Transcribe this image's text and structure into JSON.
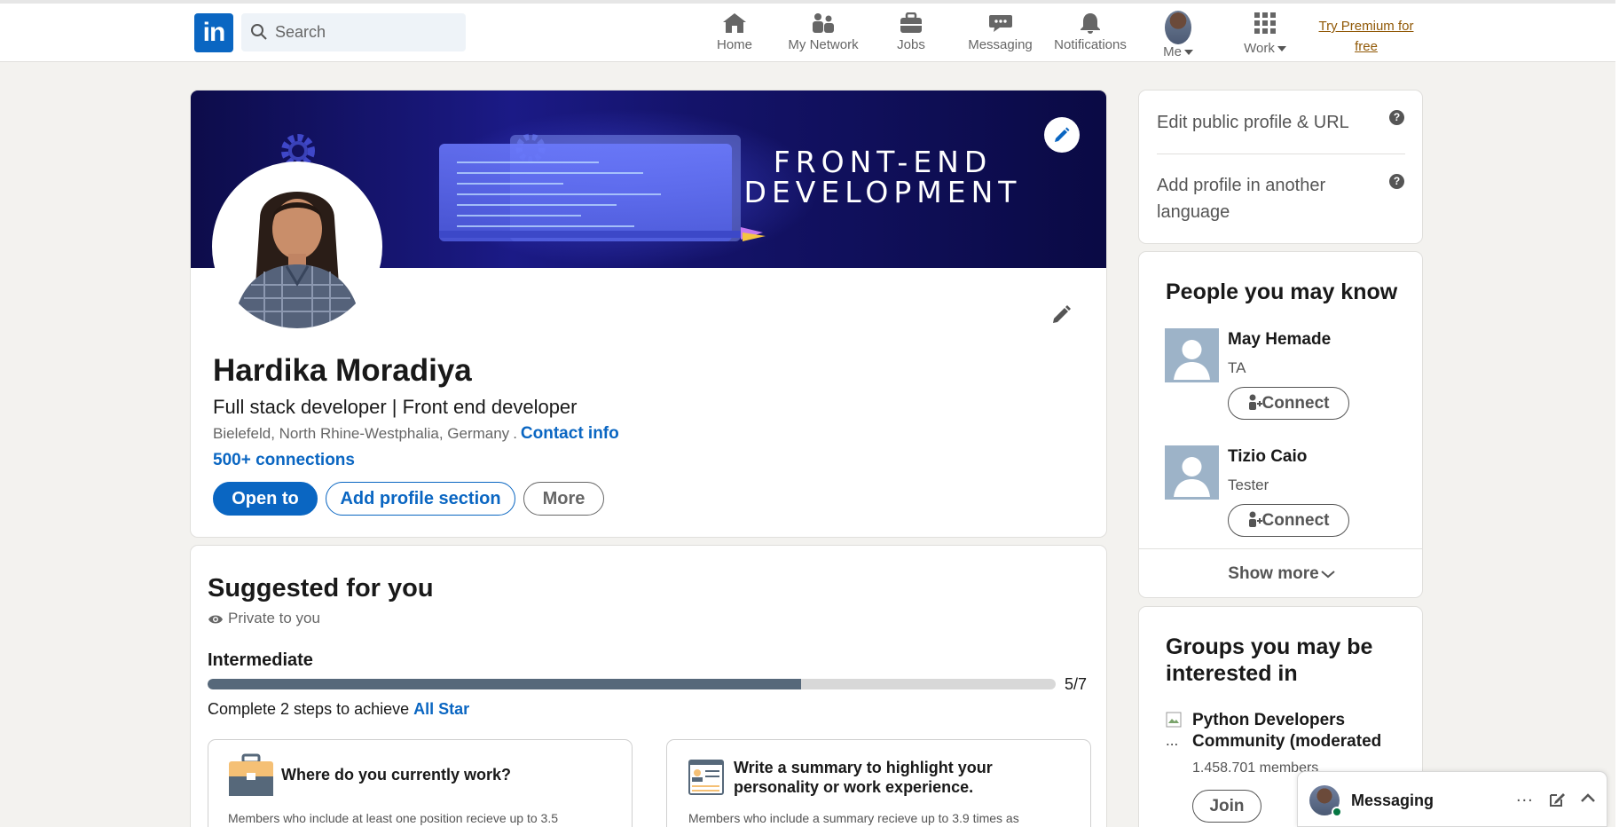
{
  "nav": {
    "search_placeholder": "Search",
    "items": [
      {
        "label": "Home",
        "icon": "home-icon"
      },
      {
        "label": "My Network",
        "icon": "network-icon"
      },
      {
        "label": "Jobs",
        "icon": "briefcase-icon"
      },
      {
        "label": "Messaging",
        "icon": "messaging-icon"
      },
      {
        "label": "Notifications",
        "icon": "bell-icon"
      },
      {
        "label": "Me",
        "icon": "avatar"
      },
      {
        "label": "Work",
        "icon": "grid-icon"
      }
    ],
    "premium": "Try Premium for free"
  },
  "profile": {
    "banner_text": "FRONT-END DEVELOPMENT",
    "name": "Hardika Moradiya",
    "headline": "Full stack developer | Front end developer",
    "location": "Bielefeld, North Rhine-Westphalia, Germany",
    "location_sep": ".",
    "contact_info": "Contact info",
    "connections": "500+ connections",
    "buttons": {
      "open_to": "Open to",
      "add_section": "Add profile section",
      "more": "More"
    }
  },
  "suggested": {
    "title": "Suggested for you",
    "private": "Private to you",
    "level": "Intermediate",
    "progress_fraction": 0.7,
    "progress_text": "5/7",
    "steps_text": "Complete 2 steps to achieve",
    "steps_link": "All Star",
    "tiles": [
      {
        "title": "Where do you currently work?",
        "body": "Members who include at least one position recieve up to 3.5"
      },
      {
        "title": "Write a summary to highlight your personality or work experience.",
        "body": "Members who include a summary recieve up to 3.9 times as"
      }
    ]
  },
  "sidebar": {
    "edit_profile": "Edit public profile & URL",
    "add_language": "Add profile in another language",
    "help_glyph": "?",
    "people_title": "People you may know",
    "people": [
      {
        "name": "May Hemade",
        "title": "TA",
        "button": "Connect"
      },
      {
        "name": "Tizio Caio",
        "title": "Tester",
        "button": "Connect"
      }
    ],
    "show_more": "Show more",
    "groups_title": "Groups you may be interested in",
    "group": {
      "img_alt": "...",
      "name": "Python Developers Community (moderated",
      "members": "1.458.701 members",
      "button": "Join"
    }
  },
  "messaging": {
    "label": "Messaging",
    "dots": "..."
  },
  "colors": {
    "brand": "#0a66c2",
    "premium": "#915907",
    "progress_fill": "#56687a",
    "online": "#057642"
  }
}
